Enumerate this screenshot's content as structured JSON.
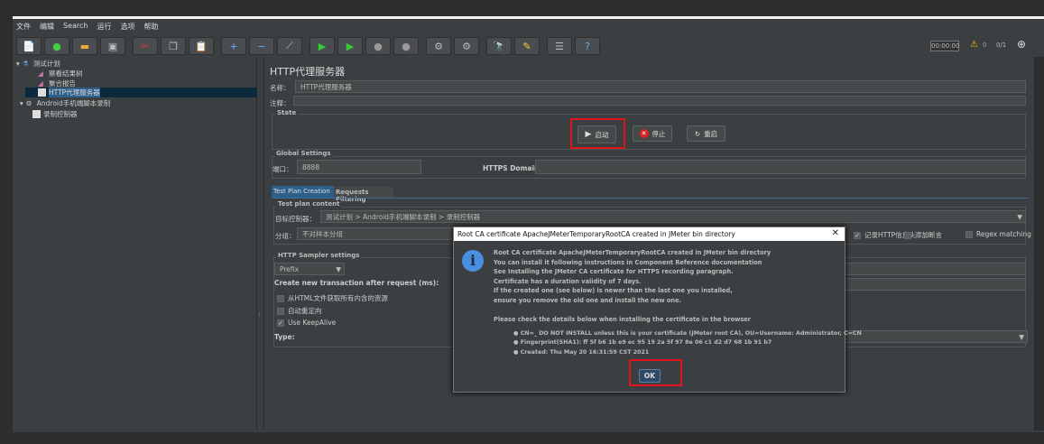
{
  "menu": [
    "文件",
    "编辑",
    "Search",
    "运行",
    "选项",
    "帮助"
  ],
  "toolbar": {
    "timer": "00:00:00",
    "warnings": "0",
    "threads": "0/1"
  },
  "tree": [
    "测试计划",
    "察看结果树",
    "聚合报告",
    "HTTP代理服务器",
    "Android手机端脚本录制",
    "录制控制器"
  ],
  "panel": {
    "title": "HTTP代理服务器",
    "name_label": "名称：",
    "name_value": "HTTP代理服务器",
    "comment_label": "注释：",
    "state_title": "State",
    "start": "启动",
    "stop": "停止",
    "restart": "重启",
    "global_title": "Global Settings",
    "port_label": "端口：",
    "port_value": "8888",
    "https_label": "HTTPS Domains:",
    "tabs": [
      "Test Plan Creation",
      "Requests Filtering"
    ],
    "content_title": "Test plan content",
    "target_label": "目标控制器：",
    "target_value": "测试计划 > Android手机端脚本录制 > 录制控制器",
    "group_label": "分组：",
    "group_value": "不对样本分组",
    "record_headers": "记录HTTP信息头",
    "add_assertions": "添加断言",
    "regex": "Regex matching",
    "sampler_title": "HTTP Sampler settings",
    "prefix": "Prefix",
    "transaction_label": "Create new transaction after request (ms):",
    "opt1": "从HTML文件获取所有内含的资源",
    "opt2": "自动重定向",
    "opt3": "Use KeepAlive",
    "type_label": "Type:"
  },
  "dialog": {
    "title": "Root CA certificate ApacheJMeterTemporaryRootCA created in JMeter bin directory",
    "lines": [
      "Root CA certificate ApacheJMeterTemporaryRootCA created in JMeter bin directory",
      "You can install it following instructions in Component Reference documentation",
      "See Installing the JMeter CA certificate for HTTPS recording paragraph.",
      "Certificate has a duration validity of 7 days.",
      "If the created one (see below) is newer than the last one you installed,",
      "ensure you remove the old one and install the new one.",
      "",
      "Please check the details below when installing the certificate in the browser"
    ],
    "bullets": [
      "CN=_ DO NOT INSTALL unless this is your certificate (JMeter root CA), OU=Username: Administrator, C=CN",
      "Fingerprint(SHA1): ff 5f b6 1b e9 ec 95 19 2a 5f 97 8e 06 c1 d2 d7 68 1b 91 b7",
      "Created: Thu May 20 16:31:59 CST 2021"
    ],
    "ok": "OK"
  },
  "colors": {
    "highlight": "#e0141c",
    "selection": "#0d293e",
    "info": "#4a90e2"
  }
}
